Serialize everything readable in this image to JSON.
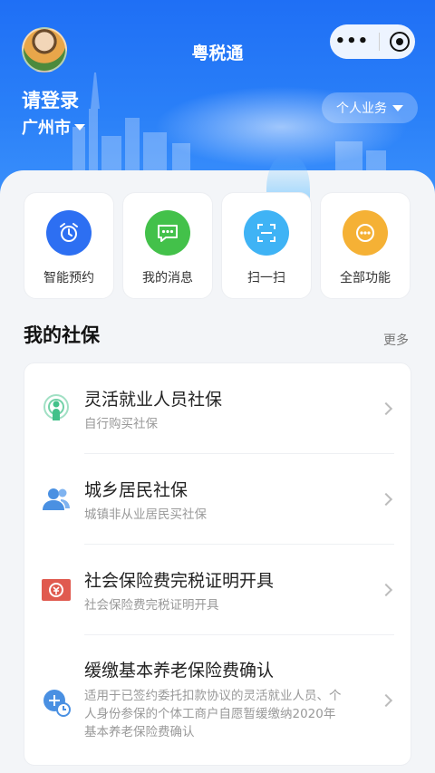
{
  "header": {
    "title": "粤税通",
    "login_text": "请登录",
    "city": "广州市",
    "biz_button": "个人业务",
    "capsule_more": "•••"
  },
  "quick_actions": [
    {
      "label": "智能预约",
      "icon": "alarm-clock-icon",
      "color": "#2d6ff2"
    },
    {
      "label": "我的消息",
      "icon": "chat-bubble-icon",
      "color": "#43c14a"
    },
    {
      "label": "扫一扫",
      "icon": "scan-icon",
      "color": "#3fb3f5"
    },
    {
      "label": "全部功能",
      "icon": "more-icon",
      "color": "#f5b135"
    }
  ],
  "section": {
    "title": "我的社保",
    "more": "更多"
  },
  "items": [
    {
      "title": "灵活就业人员社保",
      "desc": "自行购买社保",
      "icon": "flexible-employment-icon"
    },
    {
      "title": "城乡居民社保",
      "desc": "城镇非从业居民买社保",
      "icon": "residents-icon"
    },
    {
      "title": "社会保险费完税证明开具",
      "desc": "社会保险费完税证明开具",
      "icon": "tax-certificate-icon"
    },
    {
      "title": "缓缴基本养老保险费确认",
      "desc": "适用于已签约委托扣款协议的灵活就业人员、个人身份参保的个体工商户自愿暂缓缴纳2020年基本养老保险费确认",
      "icon": "deferred-payment-icon"
    }
  ],
  "colors": {
    "header_blue": "#2a80f8",
    "icon_green": "#43c18a",
    "icon_blue": "#4a90e2",
    "icon_red": "#e05a4f"
  }
}
